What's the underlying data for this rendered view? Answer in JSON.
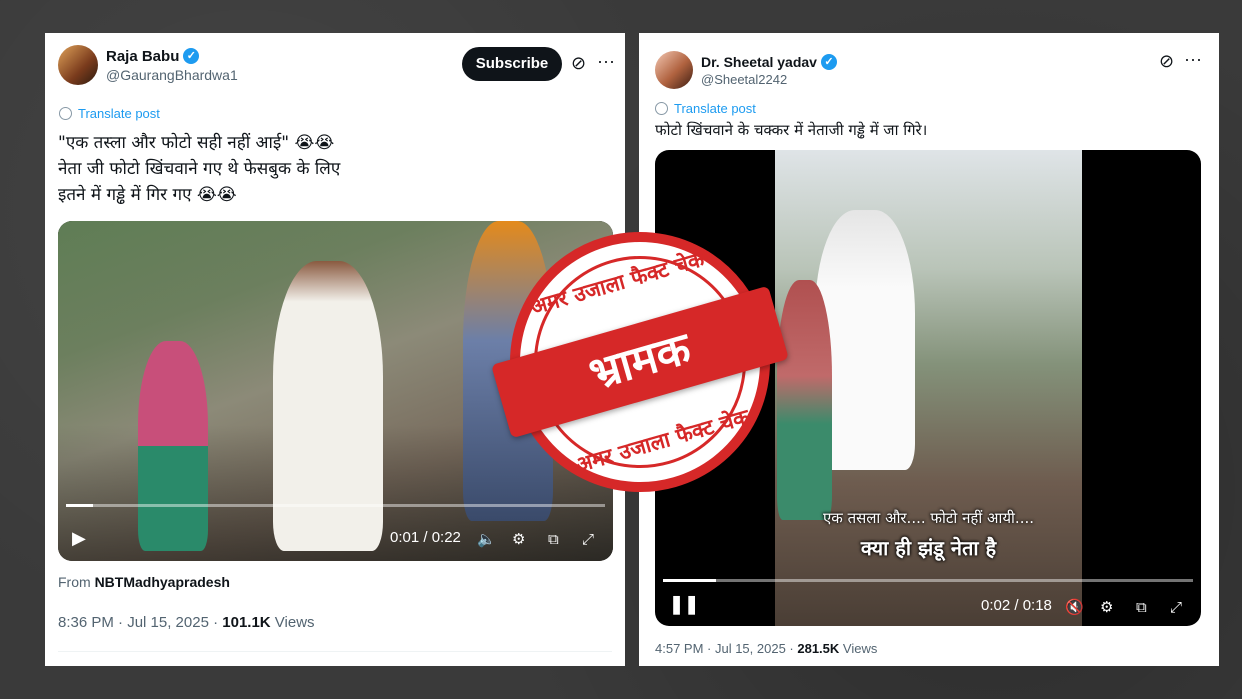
{
  "left_post": {
    "name": "Raja Babu",
    "handle": "@GaurangBhardwa1",
    "subscribe_label": "Subscribe",
    "translate_label": "Translate post",
    "text_line1": "\"एक तस्ला और फोटो सही नहीं आई\" 😭😭",
    "text_line2": "नेता जी फोटो खिंचवाने गए थे फेसबुक के लिए",
    "text_line3": "इतने में गड्ढे में गिर गए 😭😭",
    "video_time": "0:01 / 0:22",
    "video_progress": 0.05,
    "from_label": "From",
    "from_source": "NBTMadhyapradesh",
    "timestamp": "8:36 PM · Jul 15, 2025 · ",
    "views_count": "101.1K",
    "views_label": " Views"
  },
  "right_post": {
    "name": "Dr. Sheetal yadav",
    "handle": "@Sheetal2242",
    "translate_label": "Translate post",
    "text": "फोटो खिंचवाने के चक्कर में नेताजी गड्ढे में जा गिरे।",
    "caption_line1": "एक तसला और.... फोटो नहीं आयी....",
    "caption_line2": "क्या ही झंडू नेता है",
    "video_time": "0:02 / 0:18",
    "video_progress": 0.1,
    "timestamp": "4:57 PM · Jul 15, 2025 · ",
    "views_count": "281.5K",
    "views_label": " Views"
  },
  "stamp": {
    "top_text": "अमर उजाला फैक्ट चेक",
    "verdict": "भ्रामक",
    "bottom_text": "अमर उजाला फैक्ट चेक",
    "color": "#d62828"
  },
  "icons": {
    "verified": "verified-badge-icon",
    "grok": "grok-icon",
    "more": "more-icon",
    "play": "play-icon",
    "pause": "pause-icon",
    "volume": "volume-icon",
    "mute": "mute-icon",
    "settings": "gear-icon",
    "pip": "pip-icon",
    "fullscreen": "fullscreen-icon"
  },
  "colors": {
    "accent": "#1d9bf0",
    "text": "#0f1419",
    "muted": "#536471"
  }
}
